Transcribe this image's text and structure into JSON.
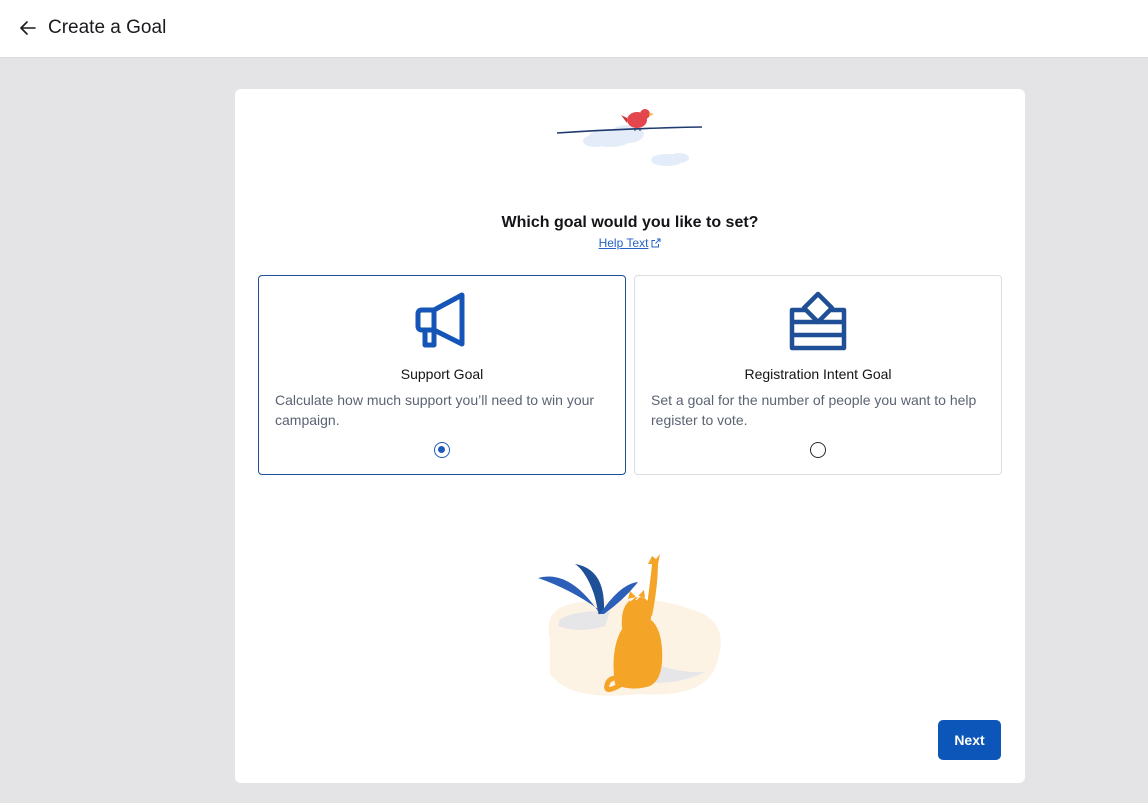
{
  "header": {
    "back_icon": "arrow-left-icon",
    "title": "Create a Goal"
  },
  "main": {
    "question": "Which goal would you like to set?",
    "help_link": "Help Text",
    "help_icon": "external-link-icon",
    "options": [
      {
        "icon": "megaphone-icon",
        "title": "Support Goal",
        "description": "Calculate how much support you’ll need to win your campaign.",
        "selected": true
      },
      {
        "icon": "ballot-box-icon",
        "title": "Registration Intent Goal",
        "description": "Set a goal for the number of people you want to help register to vote.",
        "selected": false
      }
    ],
    "next_label": "Next"
  },
  "colors": {
    "primary": "#0b56b8",
    "icon_blue": "#1655b8",
    "cat": "#f4a528",
    "bird": "#e4464d"
  }
}
